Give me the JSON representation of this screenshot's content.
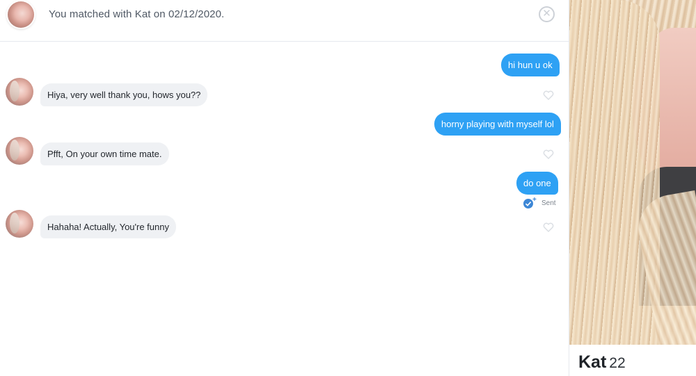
{
  "header": {
    "match_text": "You matched with Kat on 02/12/2020.",
    "close_icon": "close-circle-icon"
  },
  "messages": [
    {
      "direction": "out",
      "text": "hi hun u ok"
    },
    {
      "direction": "in",
      "text": "Hiya, very well thank you, hows you??"
    },
    {
      "direction": "out",
      "text": "horny playing with myself lol"
    },
    {
      "direction": "in",
      "text": "Pfft, On your own time mate."
    },
    {
      "direction": "out",
      "text": "do one"
    },
    {
      "direction": "in",
      "text": "Hahaha! Actually, You're funny"
    }
  ],
  "status": {
    "label": "Sent",
    "icon": "read-receipt-check-icon"
  },
  "profile": {
    "name": "Kat",
    "age": "22"
  },
  "colors": {
    "outgoing": "#2ea1f4",
    "incoming": "#eff1f4",
    "accent": "#3d87d6"
  }
}
